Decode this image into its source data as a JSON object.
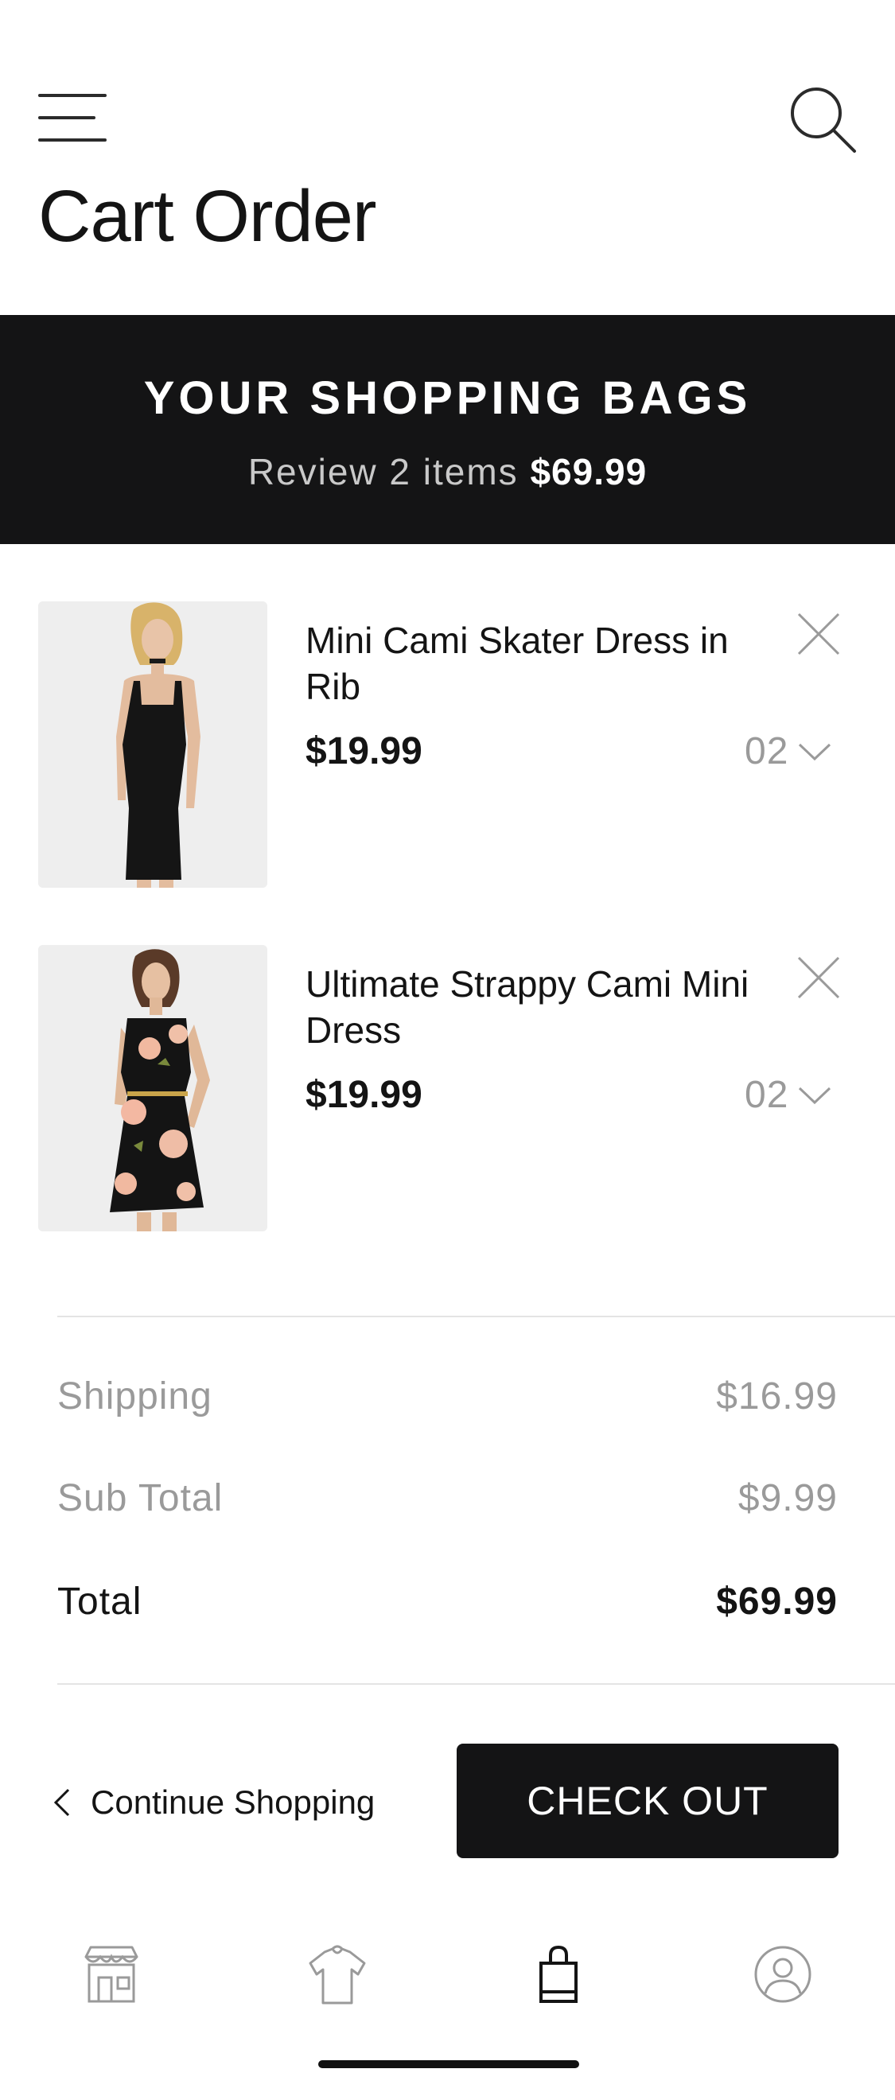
{
  "header": {
    "title": "Cart Order",
    "menu_icon": "hamburger-menu-icon",
    "search_icon": "search-icon"
  },
  "banner": {
    "title": "YOUR SHOPPING BAGS",
    "subtitle_prefix": "Review 2 items",
    "subtitle_total": "$69.99"
  },
  "cart": {
    "items": [
      {
        "name": "Mini Cami Skater Dress in Rib",
        "price": "$19.99",
        "quantity": "02",
        "image": "black-slip-dress-photo"
      },
      {
        "name": "Ultimate Strappy Cami Mini Dress",
        "price": "$19.99",
        "quantity": "02",
        "image": "floral-black-dress-photo"
      }
    ]
  },
  "summary": {
    "shipping_label": "Shipping",
    "shipping_value": "$16.99",
    "subtotal_label": "Sub Total",
    "subtotal_value": "$9.99",
    "total_label": "Total",
    "total_value": "$69.99"
  },
  "actions": {
    "continue_label": "Continue Shopping",
    "checkout_label": "CHECK OUT"
  },
  "tabbar": {
    "items": [
      "store-icon",
      "clothing-icon",
      "shopping-bag-icon",
      "profile-icon"
    ],
    "active": "shopping-bag-icon"
  },
  "colors": {
    "accent": "#141415",
    "muted_text": "#9a9a9a",
    "banner_sub": "#c9c9c9"
  }
}
